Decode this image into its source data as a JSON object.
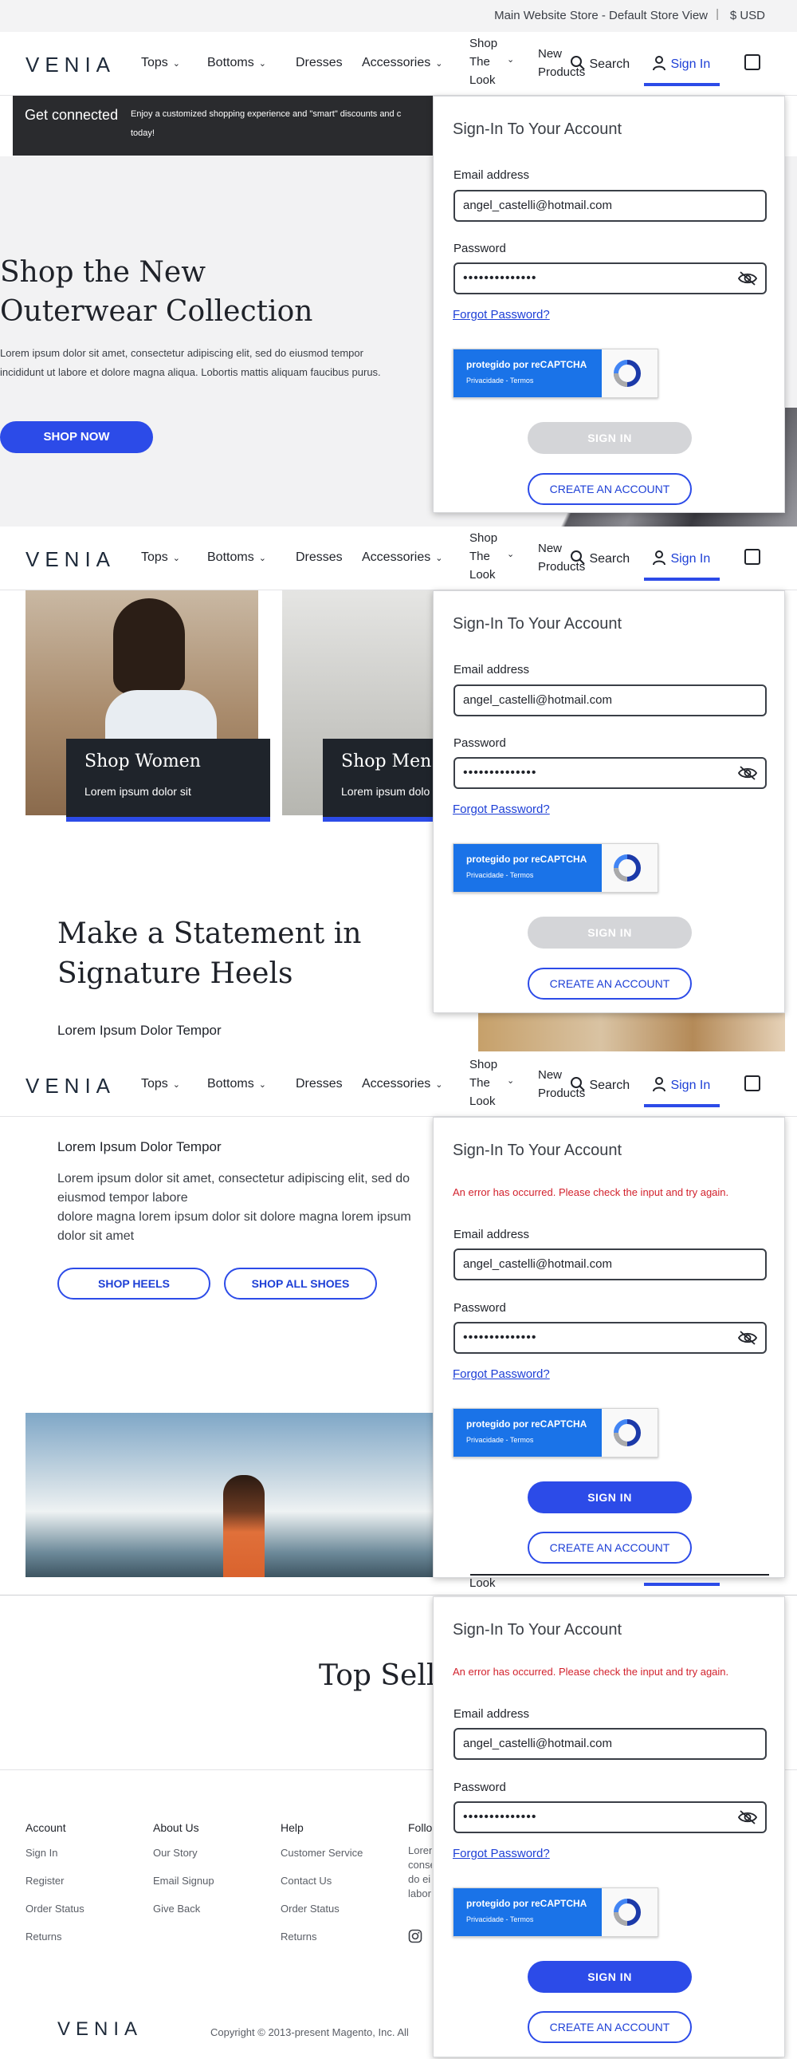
{
  "topbar": {
    "store": "Main Website Store - Default Store View",
    "separator": "|",
    "currency": "$  USD"
  },
  "nav": {
    "logo": "VENIA",
    "tops": "Tops",
    "bottoms": "Bottoms",
    "dresses": "Dresses",
    "accessories": "Accessories",
    "shop_the_look": [
      "Shop",
      "The",
      "Look"
    ],
    "new_products": [
      "New",
      "Products"
    ],
    "search": "Search",
    "signin": "Sign In",
    "look_fragment": "Look"
  },
  "promo": {
    "title": "Get connected",
    "text": "Enjoy a customized shopping experience and \"smart\" discounts and c",
    "text2": "today!"
  },
  "hero": {
    "title_line1": "Shop the New",
    "title_line2": "Outerwear Collection",
    "body": "Lorem ipsum dolor sit amet, consectetur adipiscing elit, sed do eiusmod tempor incididunt ut labore et dolore magna aliqua. Lobortis mattis aliquam faucibus purus.",
    "cta": "SHOP NOW"
  },
  "tiles": {
    "women_title": "Shop Women",
    "women_sub": "Lorem ipsum dolor sit",
    "men_title": "Shop Men",
    "men_sub": "Lorem ipsum dolo"
  },
  "heels": {
    "title_line1": "Make a Statement in",
    "title_line2": "Signature Heels",
    "subtitle": "Lorem Ipsum Dolor Tempor",
    "body_line1": "Lorem ipsum dolor sit amet, consectetur adipiscing elit, sed do",
    "body_line2": "eiusmod tempor labore",
    "body_line3": "dolore magna lorem ipsum dolor sit dolore magna lorem ipsum",
    "body_line4": "dolor sit amet",
    "shop_heels": "SHOP HEELS",
    "shop_all_shoes": "SHOP ALL SHOES"
  },
  "top_sellers": "Top Sell",
  "footer": {
    "account": {
      "heading": "Account",
      "links": [
        "Sign In",
        "Register",
        "Order Status",
        "Returns"
      ]
    },
    "about": {
      "heading": "About Us",
      "links": [
        "Our Story",
        "Email Signup",
        "Give Back"
      ]
    },
    "help": {
      "heading": "Help",
      "links": [
        "Customer Service",
        "Contact Us",
        "Order Status",
        "Returns"
      ]
    },
    "follow": {
      "heading": "Follo",
      "lines": [
        "Lorem",
        "conse",
        "do ei",
        "labor"
      ]
    },
    "logo": "VENIA",
    "copyright": "Copyright © 2013-present Magento, Inc. All"
  },
  "signin_panel": {
    "title": "Sign-In To Your Account",
    "error": "An error has occurred. Please check the input and try again.",
    "email_label": "Email address",
    "email_value": "angel_castelli@hotmail.com",
    "password_label": "Password",
    "password_value": "••••••••••••••",
    "forgot": "Forgot Password?",
    "captcha_line1": "protegido por reCAPTCHA",
    "captcha_line2": "Privacidade - Termos",
    "signin_btn": "SIGN IN",
    "create_btn": "CREATE AN ACCOUNT"
  },
  "colors": {
    "accent": "#2c4be8",
    "error": "#d2222d",
    "dark": "#1f2229"
  }
}
